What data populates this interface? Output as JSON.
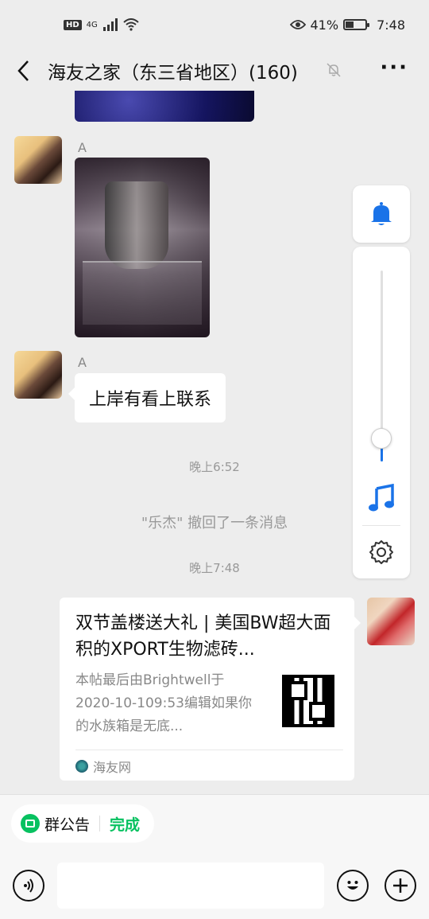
{
  "status_bar": {
    "hd": "HD",
    "network": "4G",
    "battery_percent": "41%",
    "battery_level": 0.41,
    "time": "7:48",
    "icons": [
      "signal-icon",
      "wifi-icon",
      "eye-icon",
      "battery-icon"
    ]
  },
  "header": {
    "back_icon": "chevron-left-icon",
    "title": "海友之家（东三省地区）(160)",
    "mute_icon": "bell-off-icon",
    "more_label": "···"
  },
  "messages": {
    "sender_a_1": "A",
    "sender_a_2": "A",
    "text_bubble": "上岸有看上联系",
    "time_1": "晚上6:52",
    "recall_notice": "\"乐杰\" 撤回了一条消息",
    "time_2": "晚上7:48"
  },
  "link_card": {
    "title": "双节盖楼送大礼 | 美国BW超大面积的XPORT生物滤砖...",
    "description": "本帖最后由Brightwell于2020-10-109:53编辑如果你的水族箱是无底...",
    "source": "海友网"
  },
  "side_panel": {
    "bell_icon": "bell-icon",
    "volume_level": 0.12,
    "music_icon": "music-note-icon",
    "settings_icon": "gear-icon"
  },
  "bottom": {
    "notice_label": "群公告",
    "done_label": "完成",
    "input_value": "",
    "voice_icon": "voice-icon",
    "emoji_icon": "emoji-icon",
    "plus_icon": "plus-icon"
  },
  "colors": {
    "accent_green": "#07c160",
    "accent_blue": "#1a73e8",
    "background": "#ededed"
  }
}
